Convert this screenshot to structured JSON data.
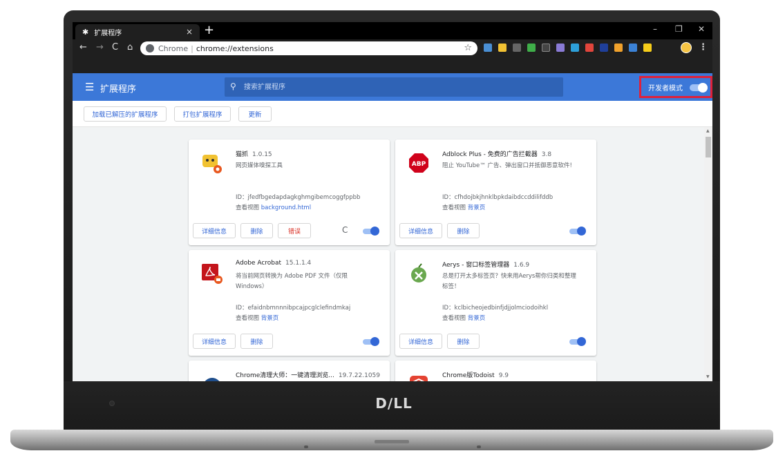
{
  "browser": {
    "tab_title": "扩展程序",
    "tab_close": "×",
    "new_tab": "+",
    "win_min": "–",
    "win_max": "❐",
    "win_close": "✕",
    "nav_back": "←",
    "nav_forward": "→",
    "nav_reload": "C",
    "nav_home": "⌂",
    "url_scheme": "Chrome",
    "url_sep": "|",
    "url_text": "chrome://extensions",
    "star": "☆",
    "menu": "⋮"
  },
  "header": {
    "hamburger": "☰",
    "title": "扩展程序",
    "search_placeholder": "搜索扩展程序",
    "search_icon": "🔍",
    "dev_mode_label": "开发者模式",
    "dev_mode_on": true
  },
  "sub_toolbar": {
    "load_unpacked": "加载已解压的扩展程序",
    "pack": "打包扩展程序",
    "update": "更新"
  },
  "cards": [
    {
      "name": "猫抓",
      "version": "1.0.15",
      "desc": "网页媒体嗅探工具",
      "id": "ID：jfedfbgedapdagkghmgibemcoggfppbb",
      "view_label": "查看视图",
      "view_link": "background.html",
      "details": "详细信息",
      "remove": "删除",
      "error": "错误",
      "reload": "C",
      "icon": "cat-extension-icon"
    },
    {
      "name": "Adblock Plus - 免费的广告拦截器",
      "version": "3.8",
      "desc": "阻止 YouTube™ 广告、弹出窗口并抵御恶意软件!",
      "id": "ID：cfhdojbkjhnklbpkdaibdccddilifddb",
      "view_label": "查看视图",
      "view_link": "背景页",
      "details": "详细信息",
      "remove": "删除",
      "icon": "abp-icon",
      "icon_text": "ABP"
    },
    {
      "name": "Adobe Acrobat",
      "version": "15.1.1.4",
      "desc": "将当前网页转换为 Adobe PDF 文件（仅限 Windows）",
      "id": "ID：efaidnbmnnnibpcajpcglclefindmkaj",
      "view_label": "查看视图",
      "view_link": "背景页",
      "details": "详细信息",
      "remove": "删除",
      "icon": "adobe-acrobat-icon"
    },
    {
      "name": "Aerys - 窗口标签管理器",
      "version": "1.6.9",
      "desc": "总是打开太多标签页？快来用Aerys帮你归类和整理标签！",
      "id": "ID：kclbicheojedbinfjdjjolmciodoihkl",
      "view_label": "查看视图",
      "view_link": "背景页",
      "details": "详细信息",
      "remove": "删除",
      "icon": "aerys-icon"
    },
    {
      "name": "Chrome清理大师：一键清理浏览...",
      "version": "19.7.22.1059",
      "icon": "cleaner-icon"
    },
    {
      "name": "Chrome版Todoist",
      "version": "9.9",
      "icon": "todoist-icon"
    }
  ],
  "brand": "D∕LL",
  "colors": {
    "header_blue": "#3c78d8",
    "highlight_red": "#e0203a",
    "link_blue": "#3367d6",
    "toggle_on": "#3367d6"
  }
}
